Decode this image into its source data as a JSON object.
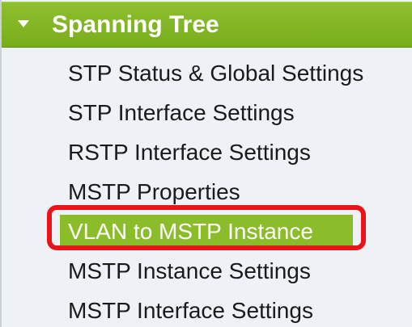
{
  "section": {
    "title": "Spanning Tree",
    "expanded_icon": "caret-down-icon"
  },
  "menu": {
    "items": [
      {
        "label": "STP Status & Global Settings"
      },
      {
        "label": "STP Interface Settings"
      },
      {
        "label": "RSTP Interface Settings"
      },
      {
        "label": "MSTP Properties"
      },
      {
        "label": "VLAN to MSTP Instance",
        "selected": true
      },
      {
        "label": "MSTP Instance Settings"
      },
      {
        "label": "MSTP Interface Settings"
      }
    ]
  },
  "colors": {
    "header_green": "#7fb322",
    "selected_green": "#8bbd2a",
    "highlight_red": "#e8141a",
    "panel_bg": "#eef2f6"
  }
}
